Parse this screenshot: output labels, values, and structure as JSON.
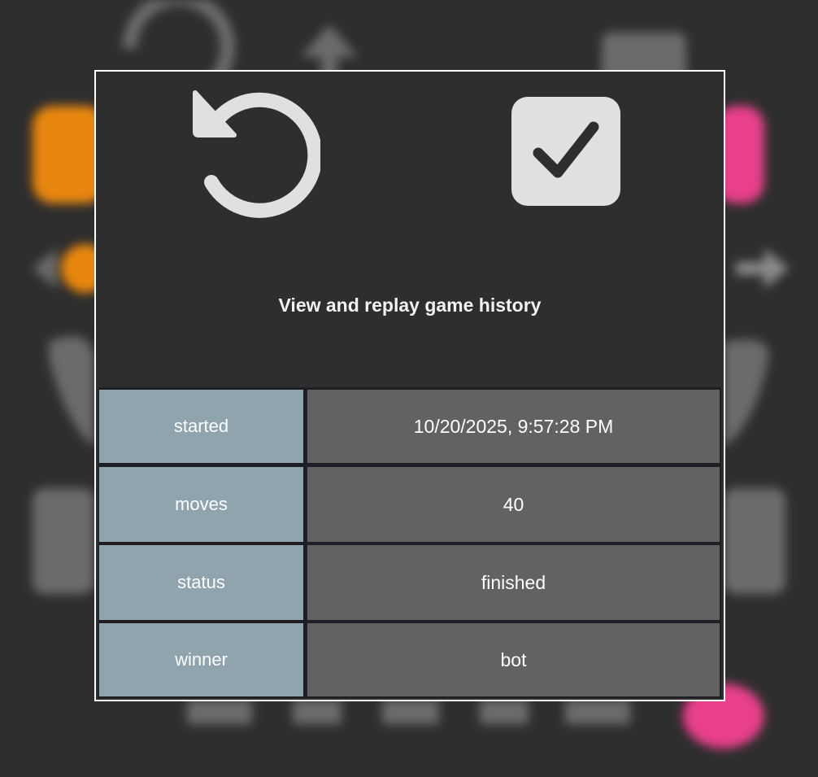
{
  "dialog": {
    "caption": "View and replay game history",
    "undo_icon": "undo-icon",
    "confirm_icon": "checkbox-checked-icon"
  },
  "game_info": {
    "rows": [
      {
        "key": "started",
        "value": "10/20/2025, 9:57:28 PM"
      },
      {
        "key": "moves",
        "value": "40"
      },
      {
        "key": "status",
        "value": "finished"
      },
      {
        "key": "winner",
        "value": "bot"
      }
    ]
  },
  "colors": {
    "overlay_bg": "#2e2e2e",
    "key_cell": "#90a4ad",
    "value_cell": "#626262",
    "icon_fill": "#e0e0e0",
    "bot_accent": "#e8870f",
    "player_accent": "#e8408a"
  }
}
